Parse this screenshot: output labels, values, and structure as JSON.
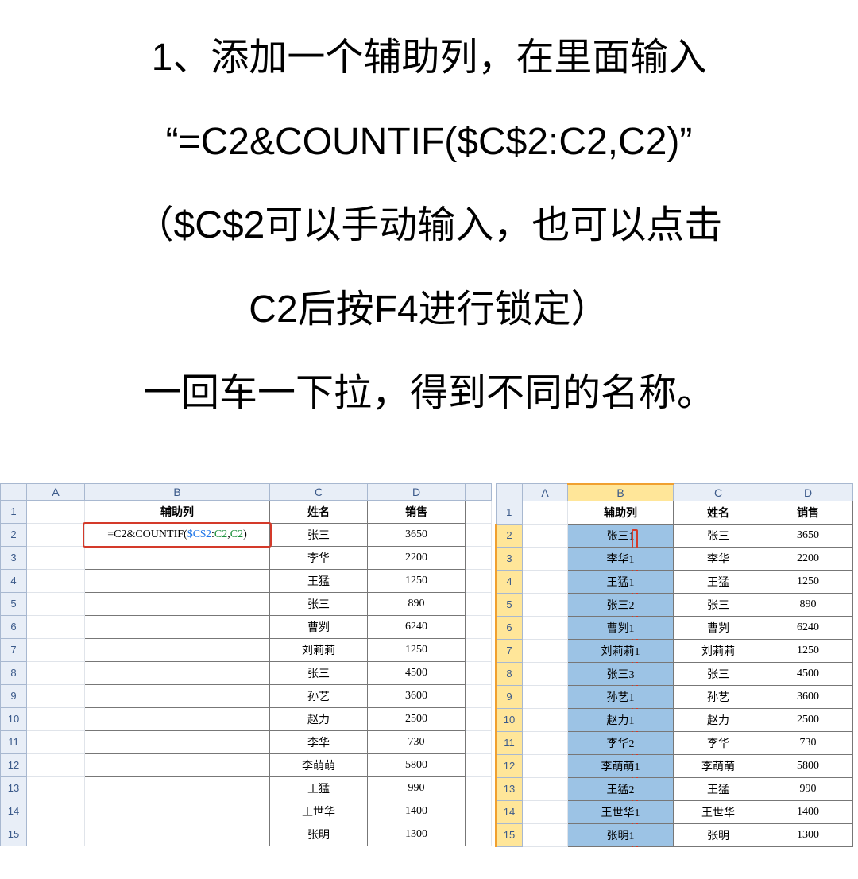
{
  "instruction": {
    "line1": "1、添加一个辅助列，在里面输入",
    "line2": "“=C2&COUNTIF($C$2:C2,C2)”",
    "line3": "（$C$2可以手动输入，也可以点击",
    "line4": "C2后按F4进行锁定）",
    "line5": "一回车一下拉，得到不同的名称。"
  },
  "columns1": {
    "a": "A",
    "b": "B",
    "c": "C",
    "d": "D"
  },
  "columns2": {
    "a": "A",
    "b": "B",
    "c": "C",
    "d": "D"
  },
  "headers": {
    "helper": "辅助列",
    "name": "姓名",
    "sales": "销售"
  },
  "formula_text": "=C2&COUNTIF($C$2:C2,C2)",
  "formula_parts": {
    "pre": "=C2&COUNTIF(",
    "abs": "$C$2",
    "mid": ":",
    "rel1": "C2",
    "sep": ",",
    "rel2": "C2",
    "end": ")"
  },
  "rows": [
    {
      "n": 2,
      "helper": "张三1",
      "name": "张三",
      "sales": "3650"
    },
    {
      "n": 3,
      "helper": "李华1",
      "name": "李华",
      "sales": "2200"
    },
    {
      "n": 4,
      "helper": "王猛1",
      "name": "王猛",
      "sales": "1250"
    },
    {
      "n": 5,
      "helper": "张三2",
      "name": "张三",
      "sales": "890"
    },
    {
      "n": 6,
      "helper": "曹刿1",
      "name": "曹刿",
      "sales": "6240"
    },
    {
      "n": 7,
      "helper": "刘莉莉1",
      "name": "刘莉莉",
      "sales": "1250"
    },
    {
      "n": 8,
      "helper": "张三3",
      "name": "张三",
      "sales": "4500"
    },
    {
      "n": 9,
      "helper": "孙艺1",
      "name": "孙艺",
      "sales": "3600"
    },
    {
      "n": 10,
      "helper": "赵力1",
      "name": "赵力",
      "sales": "2500"
    },
    {
      "n": 11,
      "helper": "李华2",
      "name": "李华",
      "sales": "730"
    },
    {
      "n": 12,
      "helper": "李萌萌1",
      "name": "李萌萌",
      "sales": "5800"
    },
    {
      "n": 13,
      "helper": "王猛2",
      "name": "王猛",
      "sales": "990"
    },
    {
      "n": 14,
      "helper": "王世华1",
      "name": "王世华",
      "sales": "1400"
    },
    {
      "n": 15,
      "helper": "张明1",
      "name": "张明",
      "sales": "1300"
    }
  ],
  "rownums": [
    "1",
    "2",
    "3",
    "4",
    "5",
    "6",
    "7",
    "8",
    "9",
    "10",
    "11",
    "12",
    "13",
    "14",
    "15"
  ]
}
